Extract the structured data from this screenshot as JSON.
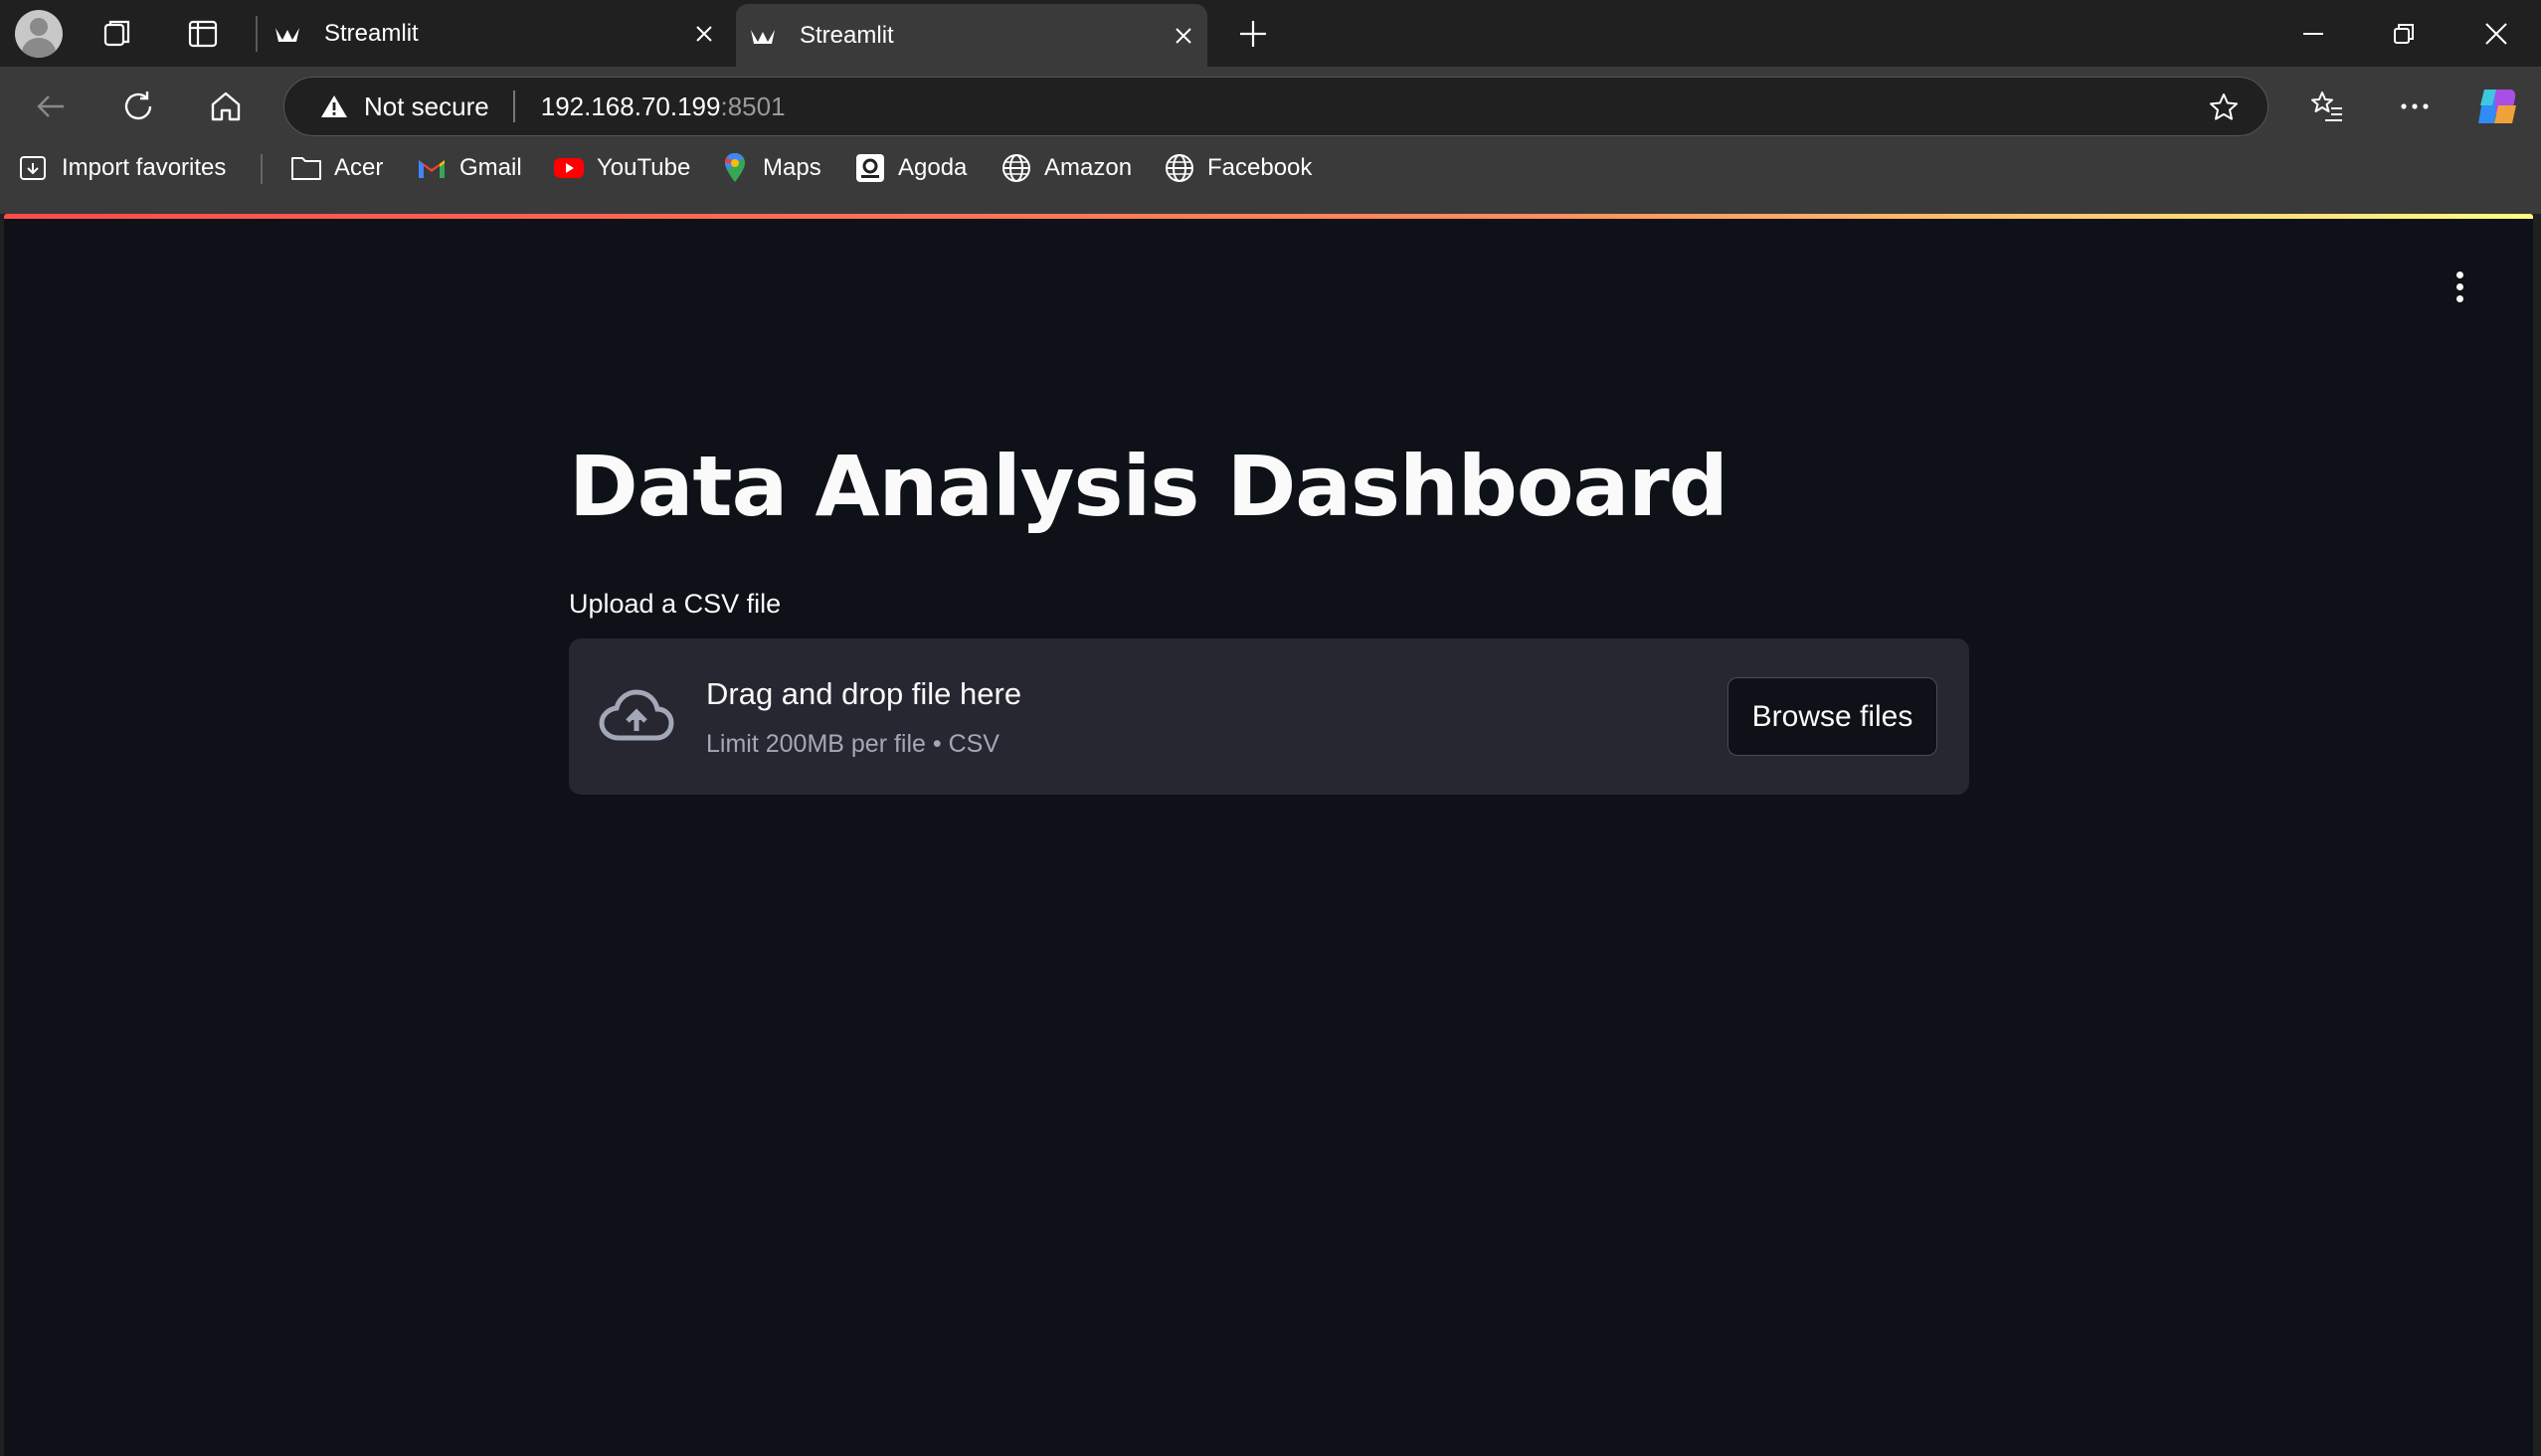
{
  "browser": {
    "tabs": [
      {
        "title": "Streamlit",
        "active": false
      },
      {
        "title": "Streamlit",
        "active": true
      }
    ],
    "address": {
      "security_label": "Not secure",
      "host": "192.168.70.199",
      "port": ":8501"
    },
    "bookmarks": [
      {
        "label": "Import favorites",
        "icon": "import-icon"
      },
      {
        "label": "Acer",
        "icon": "folder-icon"
      },
      {
        "label": "Gmail",
        "icon": "gmail-icon"
      },
      {
        "label": "YouTube",
        "icon": "youtube-icon"
      },
      {
        "label": "Maps",
        "icon": "maps-icon"
      },
      {
        "label": "Agoda",
        "icon": "agoda-icon"
      },
      {
        "label": "Amazon",
        "icon": "globe-icon"
      },
      {
        "label": "Facebook",
        "icon": "globe-icon"
      }
    ]
  },
  "app": {
    "title": "Data Analysis Dashboard",
    "uploader": {
      "label": "Upload a CSV file",
      "drop_text": "Drag and drop file here",
      "limit_text": "Limit 200MB per file • CSV",
      "button_label": "Browse files"
    },
    "colors": {
      "background": "#0e1117",
      "secondary_background": "#262730",
      "accent_gradient": [
        "#ff4b4b",
        "#fffd80"
      ]
    }
  }
}
